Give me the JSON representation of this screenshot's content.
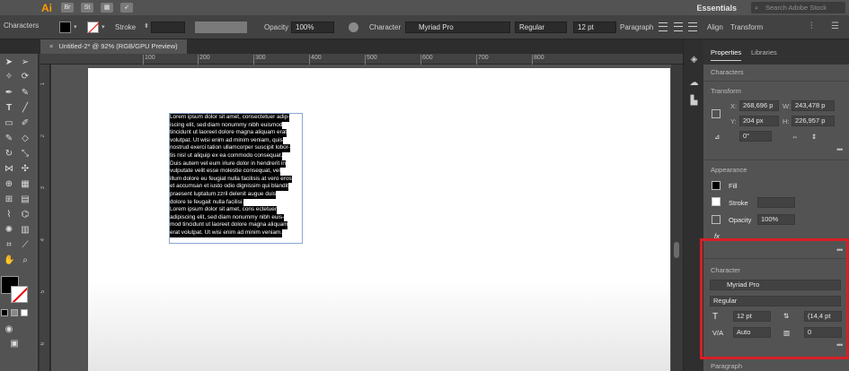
{
  "app": {
    "logo": "Ai",
    "app_icons": [
      "Br",
      "St"
    ],
    "workspace": "Essentials",
    "stock_search_placeholder": "Search Adobe Stock"
  },
  "control_bar": {
    "selection_label": "Characters",
    "stroke_label": "Stroke",
    "opacity_label": "Opacity",
    "opacity_value": "100%",
    "character_label": "Character",
    "font_family": "Myriad Pro",
    "font_style": "Regular",
    "font_size": "12 pt",
    "paragraph_label": "Paragraph",
    "align_label": "Align",
    "transform_label": "Transform"
  },
  "document": {
    "tab_title": "Untitled-2* @ 92% (RGB/GPU Preview)",
    "ruler_ticks": [
      "100",
      "200",
      "300",
      "400",
      "500",
      "600",
      "700",
      "800"
    ],
    "ruler_left_ticks": [
      "1",
      "2",
      "3",
      "4",
      "5",
      "6"
    ],
    "text_lines": [
      "Lorem ipsum dolor sit amet, consectetuer adip-",
      "iscing elit, sed diam nonummy nibh euismod",
      "tincidunt ut laoreet dolore magna aliquam erat",
      "volutpat. Ut wisi enim ad minim veniam, quis",
      "nostrud exerci tation ullamcorper suscipit lobor-",
      "tis nisl ut aliquip ex ea commodo consequat.",
      "Duis autem vel eum iriure dolor in hendrerit in",
      "vulputate velit esse molestie consequat, vel",
      "illum dolore eu feugiat nulla facilisis at vero eros",
      "et accumsan et iusto odio dignissim qui blandit",
      "praesent luptatum zzril delenit augue duis",
      "dolore te feugait nulla facilisi.",
      "Lorem ipsum dolor sit amet, cons ectetuer",
      "adipiscing elit, sed diam nonummy nibh euis-",
      "mod tincidunt ut laoreet dolore magna aliquam",
      "erat volutpat. Ut wisi enim ad minim veniam."
    ]
  },
  "panel": {
    "tabs": [
      "Properties",
      "Libraries"
    ],
    "characters_heading": "Characters",
    "transform_heading": "Transform",
    "x_label": "X:",
    "x_value": "268,696 p",
    "y_label": "Y:",
    "y_value": "204 px",
    "w_label": "W:",
    "w_value": "243,478 p",
    "h_label": "H:",
    "h_value": "226,957 p",
    "angle_value": "0°",
    "appearance_heading": "Appearance",
    "fill_label": "Fill",
    "stroke_label": "Stroke",
    "opacity_label": "Opacity",
    "opacity_value": "100%",
    "fx_label": "fx",
    "character_heading": "Character",
    "font_family": "Myriad Pro",
    "font_style": "Regular",
    "font_size": "12 pt",
    "leading": "(14,4 pt",
    "kerning": "Auto",
    "tracking": "0",
    "paragraph_heading": "Paragraph",
    "more_dots": "•••"
  },
  "colors": {
    "highlight": "#d71f26",
    "logo": "#ff9a00"
  }
}
